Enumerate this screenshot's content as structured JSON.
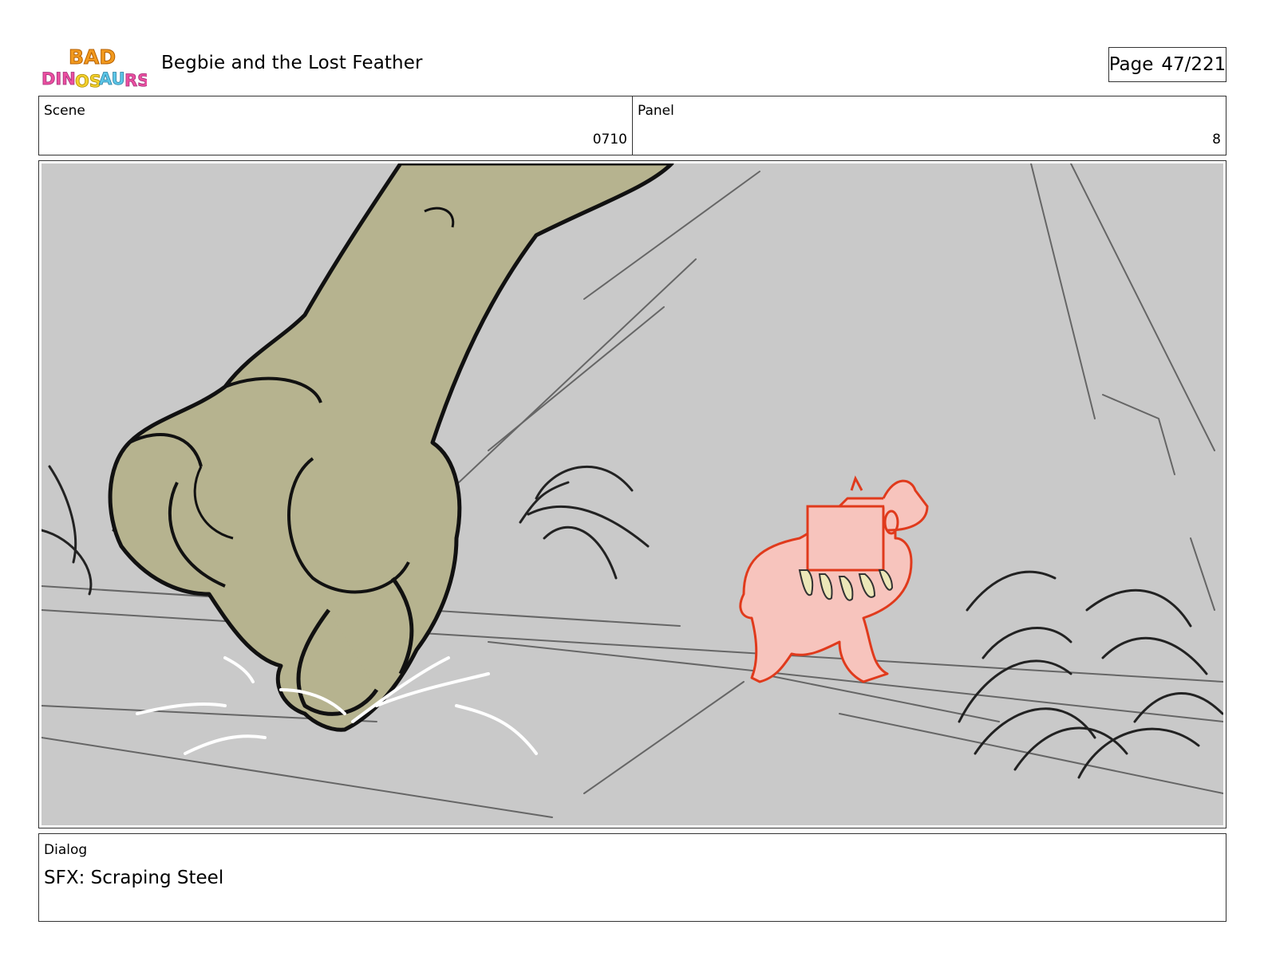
{
  "header": {
    "logo_text": "BAD DINOSAURS",
    "title": "Begbie and the Lost Feather",
    "page_label": "Page",
    "page_number": "47/221"
  },
  "scene": {
    "label": "Scene",
    "value": "0710"
  },
  "panel": {
    "label": "Panel",
    "value": "8"
  },
  "dialog": {
    "label": "Dialog",
    "text": "SFX: Scraping Steel"
  },
  "colors": {
    "panel_background": "#c9c9c9",
    "giant_foot": "#b6b38f",
    "small_dino": "#f7c4bd",
    "small_dino_outline": "#e03a1c",
    "claw": "#ece7b8",
    "logo_orange": "#f29a1e",
    "logo_pink": "#ec4fa0"
  }
}
